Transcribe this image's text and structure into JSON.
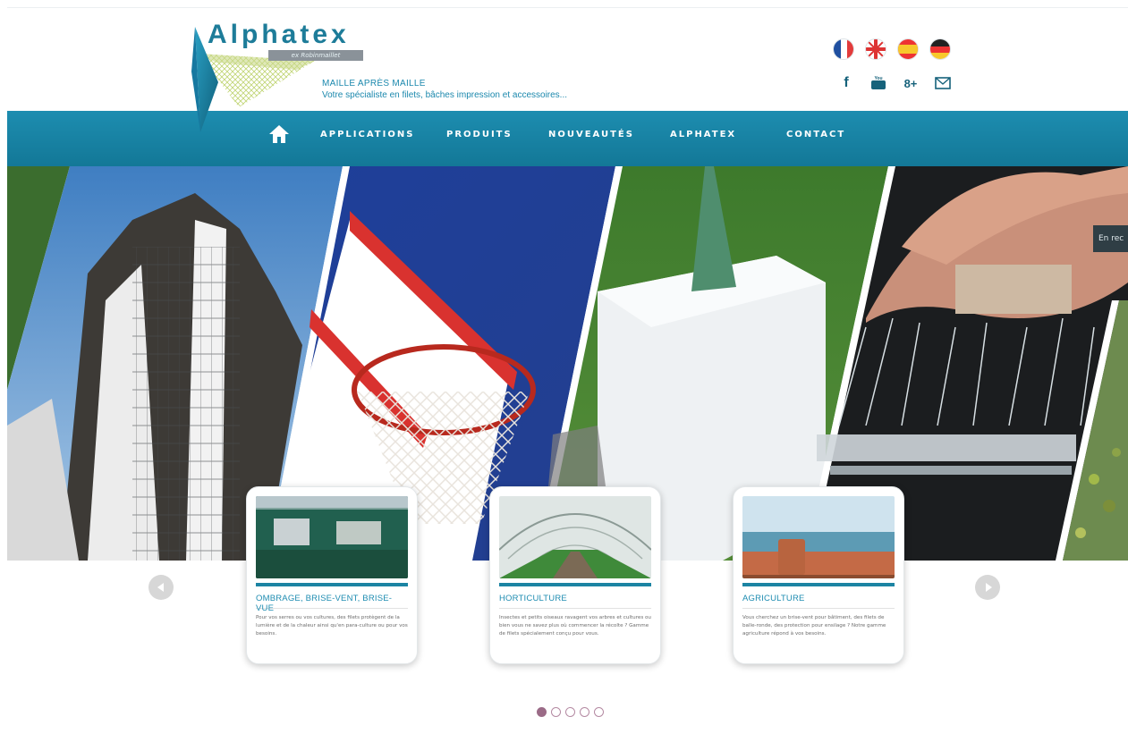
{
  "brand": {
    "name": "Alphatex",
    "sub": "ex Robinmaillet",
    "tagline_line1": "Maille après maille",
    "tagline_line2": "Votre spécialiste en filets, bâches impression et accessoires..."
  },
  "languages": [
    {
      "name": "french-flag-icon"
    },
    {
      "name": "english-flag-icon"
    },
    {
      "name": "spanish-flag-icon"
    },
    {
      "name": "german-flag-icon"
    }
  ],
  "social": {
    "facebook": "f",
    "youtube": "You",
    "googleplus": "8+"
  },
  "nav": {
    "items": [
      {
        "label": "APPLICATIONS"
      },
      {
        "label": "PRODUITS"
      },
      {
        "label": "NOUVEAUTÉS"
      },
      {
        "label": "ALPHATEX"
      },
      {
        "label": "CONTACT"
      }
    ]
  },
  "hero": {
    "badge": "En rec"
  },
  "cards": [
    {
      "title": "Ombrage, brise-vent, brise-vue",
      "desc": "Pour vos serres ou vos cultures, des filets protègent de la lumière et de la chaleur ainsi qu'en para-culture ou pour vos besoins."
    },
    {
      "title": "Horticulture",
      "desc": "Insectes et petits oiseaux ravagent vos arbres et cultures ou bien vous ne savez plus où commencer la récolte ? Gamme de filets spécialement conçu pour vous."
    },
    {
      "title": "Agriculture",
      "desc": "Vous cherchez un brise-vent pour bâtiment, des filets de balle-ronde, des protection pour ensilage ? Notre gamme agriculture répond à vos besoins."
    }
  ],
  "colors": {
    "accent": "#1b88ad",
    "nav": "#1a86a8",
    "dot_active": "#9b6b87"
  },
  "pagination": {
    "count": 5,
    "active": 1
  }
}
